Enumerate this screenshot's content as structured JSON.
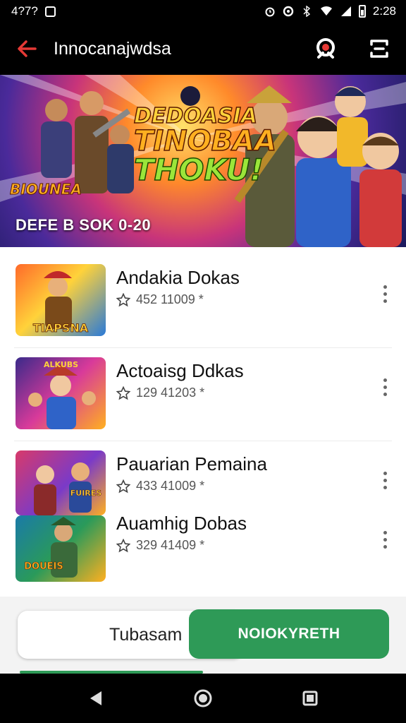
{
  "status_bar": {
    "left_text": "4?7?",
    "time": "2:28"
  },
  "app_bar": {
    "title": "Innocanajwdsa",
    "back_icon": "arrow-left-icon",
    "search_icon": "search-icon",
    "menu_icon": "layout-icon"
  },
  "banner": {
    "headline_1": "DEDOASIA",
    "headline_2": "TINOBAA",
    "headline_3": "THOKU!",
    "logo_text": "BIOUNEA",
    "subtitle": "DEFE B SOK 0-20"
  },
  "list": {
    "items": [
      {
        "title": "Andakia Dokas",
        "meta": "452 11009 *"
      },
      {
        "title": "Actoaisg Ddkas",
        "meta": "129 41203 *"
      },
      {
        "title": "Pauarian Pemaina",
        "meta": "433 41009 *"
      },
      {
        "title": "Auamhig Dobas",
        "meta": "329 41409 *"
      }
    ]
  },
  "actions": {
    "secondary_label": "Tubasam",
    "primary_label": "NOIOKYRETH"
  },
  "colors": {
    "accent_red": "#e53935",
    "primary_green": "#2e9a57"
  }
}
